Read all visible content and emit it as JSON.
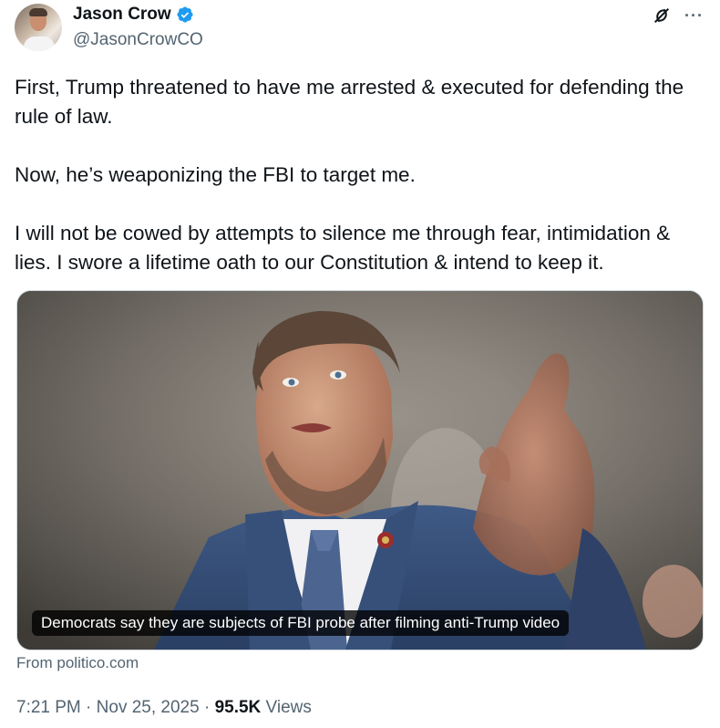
{
  "author": {
    "display_name": "Jason Crow",
    "handle": "@JasonCrowCO",
    "verified_color": "#1d9bf0"
  },
  "icons": {
    "grok": "grok-icon",
    "more": "more-icon",
    "verified": "verified-badge-icon"
  },
  "tweet": {
    "paragraphs": [
      "First, Trump threatened to have me arrested & executed for defending the rule of law.",
      "Now, he’s weaponizing the FBI to target me.",
      "I will not be cowed by attempts to silence me through fear, intimidation & lies. I swore a lifetime oath to our Constitution & intend to keep it."
    ]
  },
  "card": {
    "caption": "Democrats say they are subjects of FBI probe after filming anti-Trump video",
    "source": "From politico.com"
  },
  "meta": {
    "time": "7:21 PM",
    "sep1": " · ",
    "date": "Nov 25, 2025",
    "sep2": " · ",
    "views_count": "95.5K",
    "views_label": " Views"
  }
}
